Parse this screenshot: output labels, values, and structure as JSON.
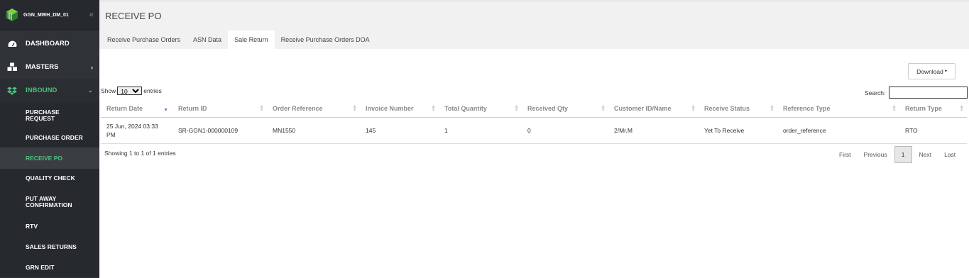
{
  "brand": {
    "name": "GGN_MWH_DM_01",
    "collapse_glyph": "«"
  },
  "nav": [
    {
      "label": "DASHBOARD",
      "icon": "dashboard-gauge-icon"
    },
    {
      "label": "MASTERS",
      "icon": "cubes-icon",
      "chevron": "›"
    },
    {
      "label": "INBOUND",
      "icon": "dropbox-icon",
      "chevron": "⌄"
    }
  ],
  "subnav": [
    {
      "label": "PURCHASE REQUEST"
    },
    {
      "label": "PURCHASE ORDER"
    },
    {
      "label": "RECEIVE PO"
    },
    {
      "label": "QUALITY CHECK"
    },
    {
      "label": "PUT AWAY CONFIRMATION"
    },
    {
      "label": "RTV"
    },
    {
      "label": "SALES RETURNS"
    },
    {
      "label": "GRN EDIT"
    }
  ],
  "page": {
    "title": "RECEIVE PO"
  },
  "tabs": [
    {
      "label": "Receive Purchase Orders"
    },
    {
      "label": "ASN Data"
    },
    {
      "label": "Sale Return"
    },
    {
      "label": "Receive Purchase Orders DOA"
    }
  ],
  "toolbar": {
    "download_label": "Download",
    "download_caret": "▾"
  },
  "length_menu": {
    "show_label": "Show",
    "selected": "10",
    "entries_label": "entries"
  },
  "search": {
    "label": "Search:",
    "value": ""
  },
  "table": {
    "headers": [
      "Return Date",
      "Return ID",
      "Order Reference",
      "Invoice Number",
      "Total Quantity",
      "Received Qty",
      "Customer ID/Name",
      "Receive Status",
      "Reference Type",
      "Return Type"
    ],
    "rows": [
      [
        "25 Jun, 2024 03:33 PM",
        "SR-GGN1-000000109",
        "MN1550",
        "145",
        "1",
        "0",
        "2/Mr.M",
        "Yet To Receive",
        "order_reference",
        "RTO"
      ]
    ]
  },
  "info": "Showing 1 to 1 of 1 entries",
  "pager": {
    "first": "First",
    "previous": "Previous",
    "current": "1",
    "next": "Next",
    "last": "Last"
  },
  "colors": {
    "sidebar_bg": "#2f3237",
    "accent_green": "#4ec07e",
    "topbar_bg": "#f1f1f1"
  }
}
